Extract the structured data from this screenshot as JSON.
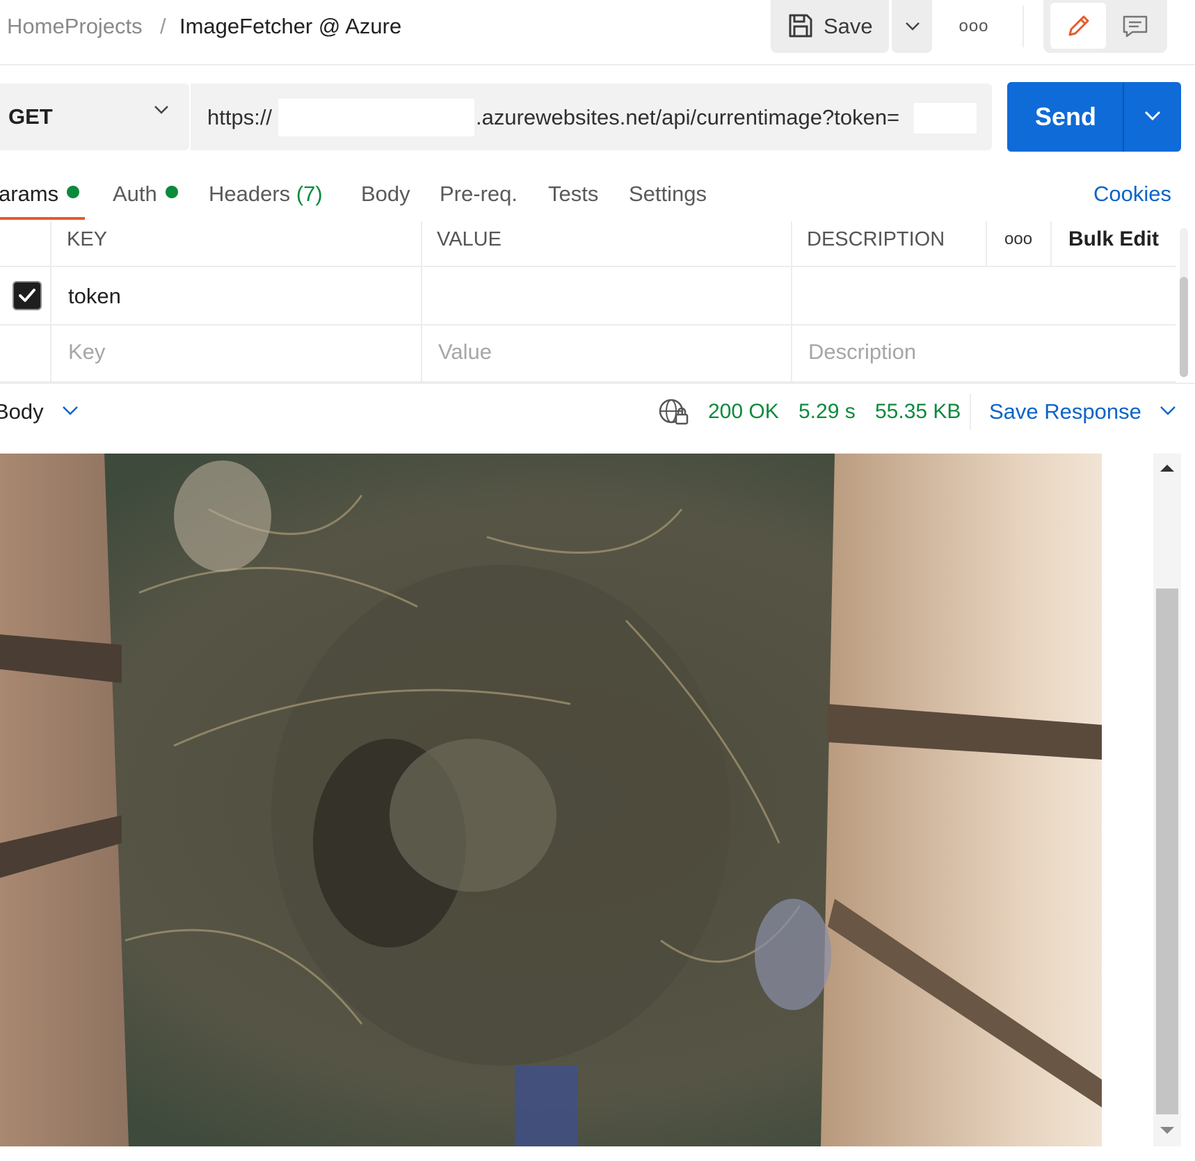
{
  "breadcrumb": {
    "workspace": "HomeProjects",
    "separator": "/",
    "request_name": "ImageFetcher @ Azure"
  },
  "toolbar": {
    "save_label": "Save",
    "more_label": "ooo"
  },
  "request": {
    "method": "GET",
    "url_prefix": "https://",
    "url_suffix": ".azurewebsites.net/api/currentimage?token=",
    "send_label": "Send"
  },
  "tabs": [
    {
      "label": "arams",
      "dot": true
    },
    {
      "label": "Auth",
      "dot": true
    },
    {
      "label": "Headers",
      "count": "(7)"
    },
    {
      "label": "Body"
    },
    {
      "label": "Pre-req."
    },
    {
      "label": "Tests"
    },
    {
      "label": "Settings"
    }
  ],
  "cookies_label": "Cookies",
  "params_table": {
    "headers": {
      "key": "KEY",
      "value": "VALUE",
      "description": "DESCRIPTION"
    },
    "more_label": "ooo",
    "bulk_edit_label": "Bulk Edit",
    "rows": [
      {
        "checked": true,
        "key": "token",
        "value": "",
        "description": ""
      }
    ],
    "placeholders": {
      "key": "Key",
      "value": "Value",
      "description": "Description"
    }
  },
  "response": {
    "body_label": "Body",
    "status": "200 OK",
    "time": "5.29 s",
    "size": "55.35 KB",
    "save_response_label": "Save Response",
    "status_color": "#0b8a3c"
  },
  "colors": {
    "accent_blue": "#0f6bd8",
    "link_blue": "#0c64c8",
    "active_tab_underline": "#e65b2b",
    "status_green": "#0b8a3c"
  },
  "icons": [
    "save-icon",
    "chevron-down-icon",
    "more-icon",
    "pencil-icon",
    "comment-icon",
    "globe-lock-icon",
    "checkmark-icon",
    "scroll-up-arrow-icon",
    "scroll-down-arrow-icon"
  ]
}
